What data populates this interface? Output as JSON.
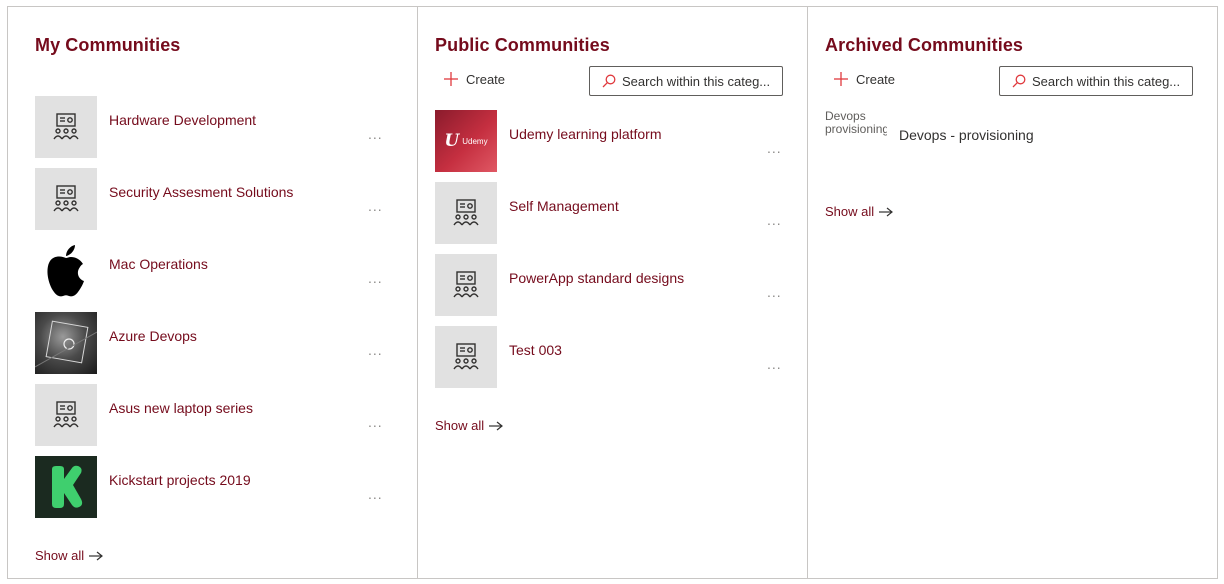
{
  "my_communities": {
    "title": "My Communities",
    "items": [
      {
        "name": "Hardware Development",
        "thumb": "community-icon"
      },
      {
        "name": "Security Assesment Solutions",
        "thumb": "community-icon"
      },
      {
        "name": "Mac Operations",
        "thumb": "apple-logo"
      },
      {
        "name": "Azure Devops",
        "thumb": "azure-photo"
      },
      {
        "name": "Asus new laptop series",
        "thumb": "community-icon"
      },
      {
        "name": "Kickstart projects 2019",
        "thumb": "kickstarter-logo"
      }
    ],
    "more_label": "...",
    "show_all": "Show all"
  },
  "public_communities": {
    "title": "Public Communities",
    "create_label": "Create",
    "search_placeholder": "Search within this categ...",
    "items": [
      {
        "name": "Udemy learning platform",
        "thumb": "udemy-logo",
        "logo_text": "Udemy"
      },
      {
        "name": "Self Management",
        "thumb": "community-icon"
      },
      {
        "name": "PowerApp standard designs",
        "thumb": "community-icon"
      },
      {
        "name": "Test 003",
        "thumb": "community-icon"
      }
    ],
    "more_label": "...",
    "show_all": "Show all"
  },
  "archived_communities": {
    "title": "Archived Communities",
    "create_label": "Create",
    "search_placeholder": "Search within this categ...",
    "items": [
      {
        "name": "Devops - provisioning",
        "broken_image_alt": "Devops provisioning"
      }
    ],
    "show_all": "Show all"
  },
  "colors": {
    "accent": "#750b1c",
    "create_plus": "#e03a3e",
    "thumb_bg": "#e1e1e1",
    "border": "#c8c6c4"
  }
}
